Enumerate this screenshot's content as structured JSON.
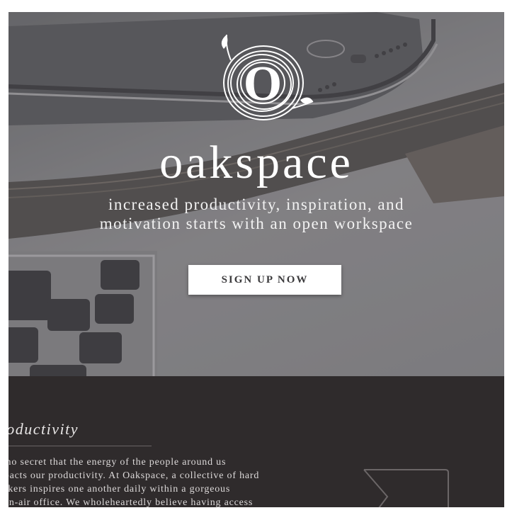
{
  "hero": {
    "brand": "oakspace",
    "tagline_line1": "increased productivity, inspiration, and",
    "tagline_line2": "motivation starts with an open workspace",
    "cta_label": "SIGN UP NOW",
    "logo_icon": "oak-ring-logo-icon",
    "logo_letter": "O"
  },
  "section": {
    "title": "roductivity",
    "paragraph": "s no secret that the energy of the people around us\nnpacts our productivity.  At Oakspace, a collective of hard\norkers inspires one another daily within a gorgeous\npen-air office.  We wholeheartedly believe having access",
    "deco_icon": "chevron-frame-icon"
  },
  "colors": {
    "dark_section": "#2f2b2c",
    "cta_bg": "#ffffff",
    "cta_text": "#3b3a3c"
  }
}
